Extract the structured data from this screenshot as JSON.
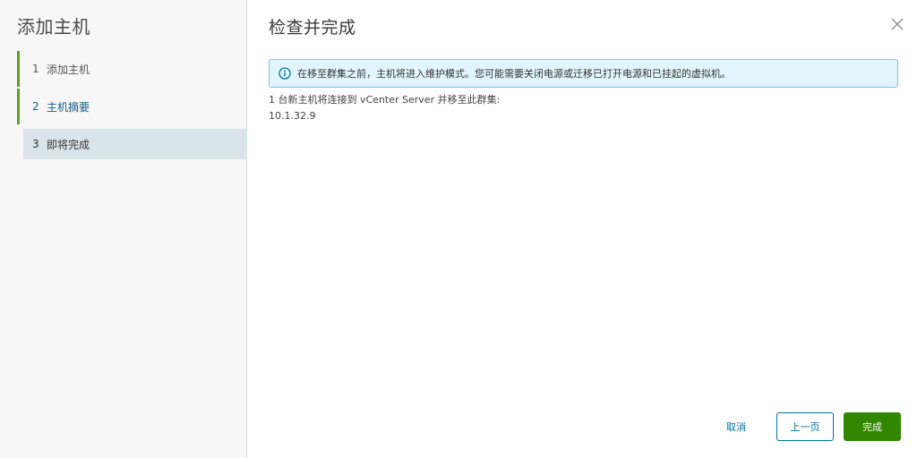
{
  "wizard": {
    "title": "添加主机",
    "steps": [
      {
        "number": "1",
        "label": "添加主机",
        "state": "completed"
      },
      {
        "number": "2",
        "label": "主机摘要",
        "state": "completed"
      },
      {
        "number": "3",
        "label": "即将完成",
        "state": "active"
      }
    ]
  },
  "page": {
    "title": "检查并完成",
    "alert": {
      "icon": "info-icon",
      "text": "在移至群集之前，主机将进入维护模式。您可能需要关闭电源或迁移已打开电源和已挂起的虚拟机。"
    },
    "summary": "1 台新主机将连接到 vCenter Server 并移至此群集:",
    "host_ip": "10.1.32.9"
  },
  "footer": {
    "cancel_label": "取消",
    "back_label": "上一页",
    "finish_label": "完成"
  },
  "colors": {
    "step_bar": "#5aa220",
    "active_step_bg": "#d9e4ea",
    "alert_bg": "#e3f5fc",
    "alert_border": "#79c6e6",
    "link_blue": "#0072a3",
    "primary_green": "#318700"
  }
}
